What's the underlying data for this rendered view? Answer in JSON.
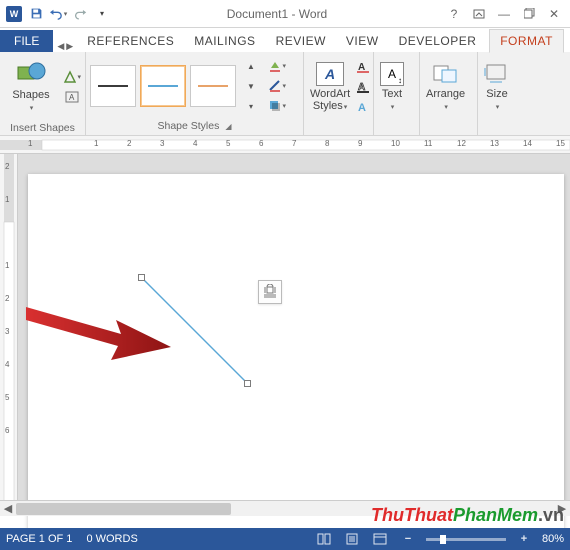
{
  "titlebar": {
    "doc_title": "Document1 - Word"
  },
  "tabs": {
    "file": "FILE",
    "items": [
      "REFERENCES",
      "MAILINGS",
      "REVIEW",
      "VIEW",
      "DEVELOPER"
    ],
    "context": "FORMAT"
  },
  "ribbon": {
    "insert_shapes": {
      "label": "Insert Shapes",
      "shapes_btn": "Shapes"
    },
    "shape_styles": {
      "label": "Shape Styles"
    },
    "wordart": {
      "label": "WordArt Styles",
      "btn": "WordArt\nStyles"
    },
    "text": {
      "label": "Text",
      "btn": "Text"
    },
    "arrange": {
      "label": "Arrange",
      "btn": "Arrange"
    },
    "size": {
      "label": "Size",
      "btn": "Size"
    }
  },
  "hruler_marks": [
    "1",
    "",
    "1",
    "2",
    "3",
    "4",
    "5",
    "6",
    "7",
    "8",
    "9",
    "10",
    "11",
    "12",
    "13",
    "14",
    "15"
  ],
  "vruler_marks": [
    "2",
    "1",
    "",
    "1",
    "2",
    "3",
    "4",
    "5",
    "6"
  ],
  "status": {
    "page": "PAGE 1 OF 1",
    "words": "0 WORDS",
    "zoom": "80%"
  },
  "watermark": {
    "a": "ThuThuat",
    "b": "PhanMem",
    "c": ".vn"
  },
  "colors": {
    "swatches": [
      "#3b3b3b",
      "#5aa7d6",
      "#e8a36a"
    ]
  }
}
